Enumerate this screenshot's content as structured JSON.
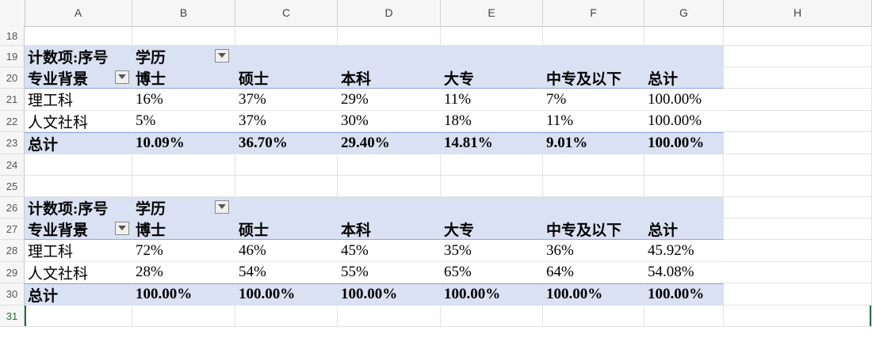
{
  "columns": [
    "A",
    "B",
    "C",
    "D",
    "E",
    "F",
    "G",
    "H"
  ],
  "rows": [
    {
      "num": "18",
      "cells": [
        "",
        "",
        "",
        "",
        "",
        "",
        ""
      ]
    },
    {
      "num": "19",
      "cells": [
        "计数项:序号",
        "学历",
        "",
        "",
        "",
        "",
        ""
      ]
    },
    {
      "num": "20",
      "cells": [
        "专业背景",
        "博士",
        "硕士",
        "本科",
        "大专",
        "中专及以下",
        "总计"
      ]
    },
    {
      "num": "21",
      "cells": [
        "理工科",
        "16%",
        "37%",
        "29%",
        "11%",
        "7%",
        "100.00%"
      ]
    },
    {
      "num": "22",
      "cells": [
        "人文社科",
        "5%",
        "37%",
        "30%",
        "18%",
        "11%",
        "100.00%"
      ]
    },
    {
      "num": "23",
      "cells": [
        "总计",
        "10.09%",
        "36.70%",
        "29.40%",
        "14.81%",
        "9.01%",
        "100.00%"
      ]
    },
    {
      "num": "24",
      "cells": [
        "",
        "",
        "",
        "",
        "",
        "",
        ""
      ]
    },
    {
      "num": "25",
      "cells": [
        "",
        "",
        "",
        "",
        "",
        "",
        ""
      ]
    },
    {
      "num": "26",
      "cells": [
        "计数项:序号",
        "学历",
        "",
        "",
        "",
        "",
        ""
      ]
    },
    {
      "num": "27",
      "cells": [
        "专业背景",
        "博士",
        "硕士",
        "本科",
        "大专",
        "中专及以下",
        "总计"
      ]
    },
    {
      "num": "28",
      "cells": [
        "理工科",
        "72%",
        "46%",
        "45%",
        "35%",
        "36%",
        "45.92%"
      ]
    },
    {
      "num": "29",
      "cells": [
        "人文社科",
        "28%",
        "54%",
        "55%",
        "65%",
        "64%",
        "54.08%"
      ]
    },
    {
      "num": "30",
      "cells": [
        "总计",
        "100.00%",
        "100.00%",
        "100.00%",
        "100.00%",
        "100.00%",
        "100.00%"
      ]
    },
    {
      "num": "31",
      "cells": [
        "",
        "",
        "",
        "",
        "",
        "",
        ""
      ]
    }
  ],
  "colors": {
    "pivot_fill": "#d9e1f2",
    "pivot_rule": "#8ea9db",
    "selection": "#1e7145"
  },
  "icons": {
    "filter_dropdown": "chevron-down-icon"
  }
}
